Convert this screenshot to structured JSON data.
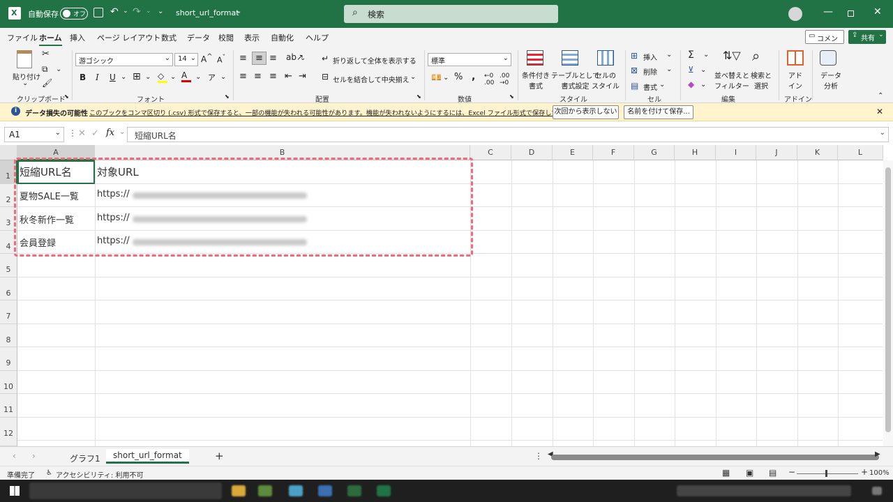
{
  "title_bar": {
    "autosave_label": "自動保存",
    "autosave_state": "オフ",
    "file_name": "short_url_format",
    "search_placeholder": "検索"
  },
  "menu": {
    "tabs": [
      "ファイル",
      "ホーム",
      "挿入",
      "ページ レイアウト",
      "数式",
      "データ",
      "校閲",
      "表示",
      "自動化",
      "ヘルプ"
    ],
    "active": "ホーム",
    "comment_label": "コメント",
    "share_label": "共有"
  },
  "ribbon": {
    "clipboard": {
      "paste_label": "貼り付け",
      "group_label": "クリップボード"
    },
    "font": {
      "font_name": "游ゴシック",
      "font_size": "14",
      "group_label": "フォント"
    },
    "alignment": {
      "wrap_label": "折り返して全体を表示する",
      "merge_label": "セルを結合して中央揃え",
      "group_label": "配置"
    },
    "number": {
      "format": "標準",
      "group_label": "数値"
    },
    "styles": {
      "conditional_label": "条件付き\n書式",
      "table_label": "テーブルとして\n書式設定",
      "cell_style_label": "セルの\nスタイル",
      "group_label": "スタイル"
    },
    "cells": {
      "insert_label": "挿入",
      "delete_label": "削除",
      "format_label": "書式",
      "group_label": "セル"
    },
    "editing": {
      "sort_label": "並べ替えと\nフィルター",
      "find_label": "検索と\n選択",
      "group_label": "編集"
    },
    "addins": {
      "addin_label": "アド\nイン",
      "group_label": "アドイン"
    },
    "analysis": {
      "label": "データ\n分析"
    }
  },
  "infobar": {
    "title": "データ損失の可能性",
    "message": "このブックをコンマ区切り (.csv) 形式で保存すると、一部の機能が失われる可能性があります。機能が失われないようにするには、Excel ファイル形式で保存してください。",
    "dismiss_label": "次回から表示しない",
    "saveas_label": "名前を付けて保存..."
  },
  "formula_bar": {
    "name_box": "A1",
    "formula": "短縮URL名"
  },
  "grid": {
    "columns": [
      "A",
      "B",
      "C",
      "D",
      "E",
      "F",
      "G",
      "H",
      "I",
      "J",
      "K",
      "L"
    ],
    "rows": [
      "1",
      "2",
      "3",
      "4",
      "5",
      "6",
      "7",
      "8",
      "9",
      "10",
      "11",
      "12"
    ],
    "cells": {
      "A1": "短縮URL名",
      "B1": "対象URL",
      "A2": "夏物SALE一覧",
      "B2": "https://",
      "A3": "秋冬新作一覧",
      "B3": "https://",
      "A4": "会員登録",
      "B4": "https://"
    }
  },
  "sheets": {
    "tabs": [
      "グラフ1",
      "short_url_format"
    ],
    "active": "short_url_format"
  },
  "status": {
    "ready": "準備完了",
    "accessibility": "アクセシビリティ: 利用不可",
    "zoom": "100%"
  }
}
